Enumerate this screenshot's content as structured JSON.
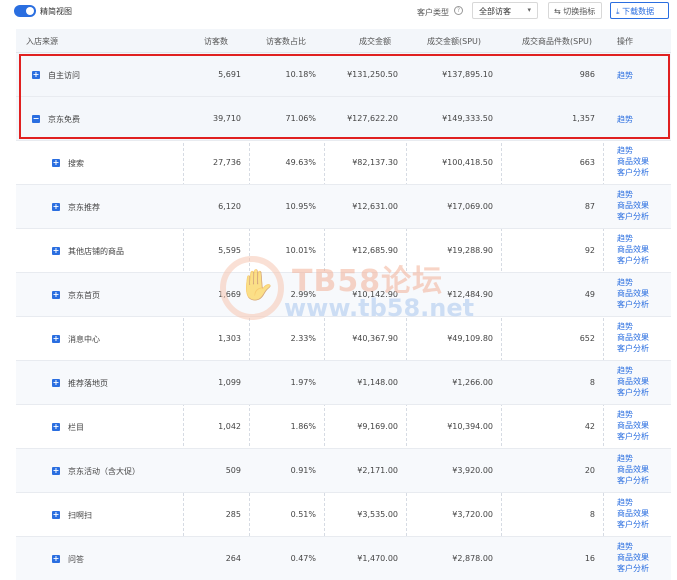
{
  "topbar": {
    "toggle_label": "精简视图",
    "customer_type_label": "客户类型",
    "customer_type_value": "全部访客",
    "switch_metrics_label": "切换指标",
    "download_label": "下载数据"
  },
  "columns": {
    "source": "入店来源",
    "visitors": "访客数",
    "visitor_pct": "访客数占比",
    "amount": "成交金额",
    "amount_spu": "成交金额(SPU)",
    "items_spu": "成交商品件数(SPU)",
    "ops": "操作"
  },
  "links": {
    "trend": "趋势",
    "product_effect": "商品效果",
    "customer_analysis": "客户分析"
  },
  "rows": [
    {
      "expander": "+",
      "source": "自主访问",
      "visitors": "5,691",
      "pct": "10.18%",
      "amount": "¥131,250.50",
      "amount_spu": "¥137,895.10",
      "items": "986"
    },
    {
      "expander": "−",
      "source": "京东免费",
      "visitors": "39,710",
      "pct": "71.06%",
      "amount": "¥127,622.20",
      "amount_spu": "¥149,333.50",
      "items": "1,357"
    },
    {
      "expander": "+",
      "source": "搜索",
      "visitors": "27,736",
      "pct": "49.63%",
      "amount": "¥82,137.30",
      "amount_spu": "¥100,418.50",
      "items": "663"
    },
    {
      "expander": "+",
      "source": "京东推荐",
      "visitors": "6,120",
      "pct": "10.95%",
      "amount": "¥12,631.00",
      "amount_spu": "¥17,069.00",
      "items": "87"
    },
    {
      "expander": "+",
      "source": "其他店铺的商品",
      "visitors": "5,595",
      "pct": "10.01%",
      "amount": "¥12,685.90",
      "amount_spu": "¥19,288.90",
      "items": "92"
    },
    {
      "expander": "+",
      "source": "京东首页",
      "visitors": "1,669",
      "pct": "2.99%",
      "amount": "¥10,142.90",
      "amount_spu": "¥12,484.90",
      "items": "49"
    },
    {
      "expander": "+",
      "source": "消息中心",
      "visitors": "1,303",
      "pct": "2.33%",
      "amount": "¥40,367.90",
      "amount_spu": "¥49,109.80",
      "items": "652"
    },
    {
      "expander": "+",
      "source": "推荐落地页",
      "visitors": "1,099",
      "pct": "1.97%",
      "amount": "¥1,148.00",
      "amount_spu": "¥1,266.00",
      "items": "8"
    },
    {
      "expander": "+",
      "source": "栏目",
      "visitors": "1,042",
      "pct": "1.86%",
      "amount": "¥9,169.00",
      "amount_spu": "¥10,394.00",
      "items": "42"
    },
    {
      "expander": "+",
      "source": "京东活动（含大促）",
      "visitors": "509",
      "pct": "0.91%",
      "amount": "¥2,171.00",
      "amount_spu": "¥3,920.00",
      "items": "20"
    },
    {
      "expander": "+",
      "source": "扫啊扫",
      "visitors": "285",
      "pct": "0.51%",
      "amount": "¥3,535.00",
      "amount_spu": "¥3,720.00",
      "items": "8"
    },
    {
      "expander": "+",
      "source": "问答",
      "visitors": "264",
      "pct": "0.47%",
      "amount": "¥1,470.00",
      "amount_spu": "¥2,878.00",
      "items": "16"
    }
  ],
  "watermark": {
    "title": "TB58论坛",
    "url": "www.tb58.net"
  },
  "colors": {
    "accent": "#2a6ee0",
    "highlight": "#e02020"
  }
}
